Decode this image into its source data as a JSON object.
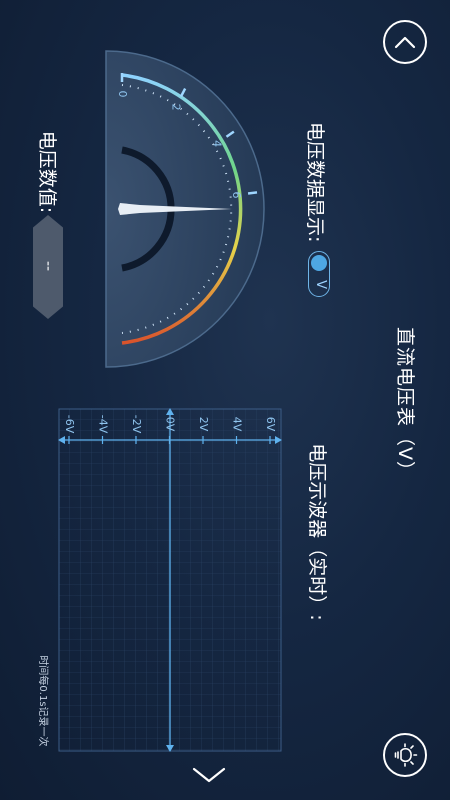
{
  "header": {
    "title": "直流电压表（V）"
  },
  "display": {
    "label": "电压数据显示:",
    "unit_toggle_label": "V"
  },
  "gauge": {
    "tick_labels": [
      "-6",
      "-4",
      "-2",
      "0",
      "2",
      "4",
      "6"
    ],
    "value": 0
  },
  "value_box": {
    "label": "电压数值:",
    "value": "--"
  },
  "scope": {
    "title": "电压示波器（实时）:",
    "tick_labels": [
      "6V",
      "4V",
      "2V",
      "0V",
      "-2V",
      "-4V",
      "-6V"
    ],
    "footer": "时间每0.1s记录一次"
  },
  "icons": {
    "top": "chevron-up-icon",
    "bottom": "chevron-down-icon",
    "corner": "bulb-icon"
  },
  "colors": {
    "accent": "#4ea7e3",
    "needle": "#e8eef5",
    "arc_red": "#d9532c",
    "arc_yellow": "#e6d24a",
    "arc_green": "#6fd58a"
  }
}
